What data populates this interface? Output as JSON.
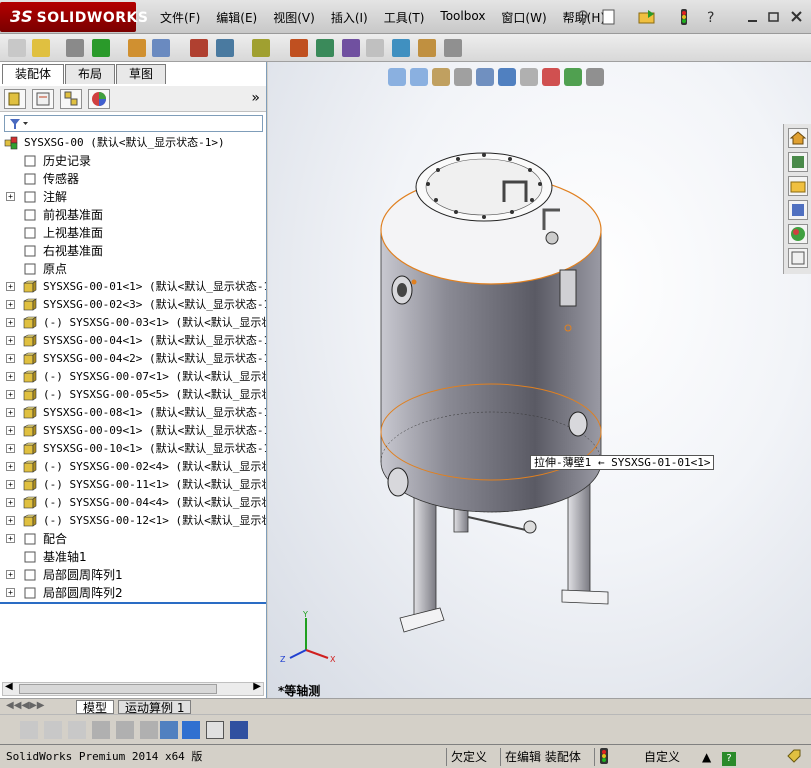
{
  "app": {
    "logo_text": "SOLIDWORKS",
    "brand_color": "#a00000"
  },
  "menu": {
    "items": [
      "文件(F)",
      "编辑(E)",
      "视图(V)",
      "插入(I)",
      "工具(T)",
      "Toolbox",
      "窗口(W)",
      "帮助(H)"
    ]
  },
  "panel": {
    "tabs": [
      "装配体",
      "布局",
      "草图"
    ],
    "expand_label": "»"
  },
  "tree": {
    "root": "SYSXSG-00  (默认<默认_显示状态-1>)",
    "items": [
      {
        "label": "历史记录",
        "mono": false,
        "expand": false
      },
      {
        "label": "传感器",
        "mono": false,
        "expand": false
      },
      {
        "label": "注解",
        "mono": false,
        "expand": true
      },
      {
        "label": "前视基准面",
        "mono": false,
        "expand": false
      },
      {
        "label": "上视基准面",
        "mono": false,
        "expand": false
      },
      {
        "label": "右视基准面",
        "mono": false,
        "expand": false
      },
      {
        "label": "原点",
        "mono": false,
        "expand": false
      },
      {
        "label": "SYSXSG-00-01<1> (默认<默认_显示状态-1",
        "mono": true,
        "expand": true
      },
      {
        "label": "SYSXSG-00-02<3> (默认<默认_显示状态-1",
        "mono": true,
        "expand": true
      },
      {
        "label": "(-) SYSXSG-00-03<1> (默认<默认_显示状",
        "mono": true,
        "expand": true
      },
      {
        "label": "SYSXSG-00-04<1> (默认<默认_显示状态-1",
        "mono": true,
        "expand": true
      },
      {
        "label": "SYSXSG-00-04<2> (默认<默认_显示状态-1",
        "mono": true,
        "expand": true
      },
      {
        "label": "(-) SYSXSG-00-07<1> (默认<默认_显示状",
        "mono": true,
        "expand": true
      },
      {
        "label": "(-) SYSXSG-00-05<5> (默认<默认_显示状",
        "mono": true,
        "expand": true
      },
      {
        "label": "SYSXSG-00-08<1> (默认<默认_显示状态-1",
        "mono": true,
        "expand": true
      },
      {
        "label": "SYSXSG-00-09<1> (默认<默认_显示状态-1",
        "mono": true,
        "expand": true
      },
      {
        "label": "SYSXSG-00-10<1> (默认<默认_显示状态-1",
        "mono": true,
        "expand": true
      },
      {
        "label": "(-) SYSXSG-00-02<4> (默认<默认_显示状",
        "mono": true,
        "expand": true
      },
      {
        "label": "(-) SYSXSG-00-11<1> (默认<默认_显示状",
        "mono": true,
        "expand": true
      },
      {
        "label": "(-) SYSXSG-00-04<4> (默认<默认_显示状",
        "mono": true,
        "expand": true
      },
      {
        "label": "(-) SYSXSG-00-12<1> (默认<默认_显示状",
        "mono": true,
        "expand": true
      },
      {
        "label": "配合",
        "mono": false,
        "expand": true
      },
      {
        "label": "基准轴1",
        "mono": false,
        "expand": false
      },
      {
        "label": "局部圆周阵列1",
        "mono": false,
        "expand": true
      },
      {
        "label": "局部圆周阵列2",
        "mono": false,
        "expand": true
      }
    ]
  },
  "bottom_tabs": [
    "模型",
    "运动算例 1"
  ],
  "viewport": {
    "tooltip": "拉伸-薄壁1 ← SYSXSG-01-01<1>",
    "view_name": "*等轴测",
    "triad": {
      "x": "X",
      "y": "Y",
      "z": "Z"
    }
  },
  "status": {
    "app_version": "SolidWorks Premium 2014 x64 版",
    "state": "欠定义",
    "editing": "在编辑 装配体",
    "custom": "自定义",
    "help_icon": "?"
  }
}
